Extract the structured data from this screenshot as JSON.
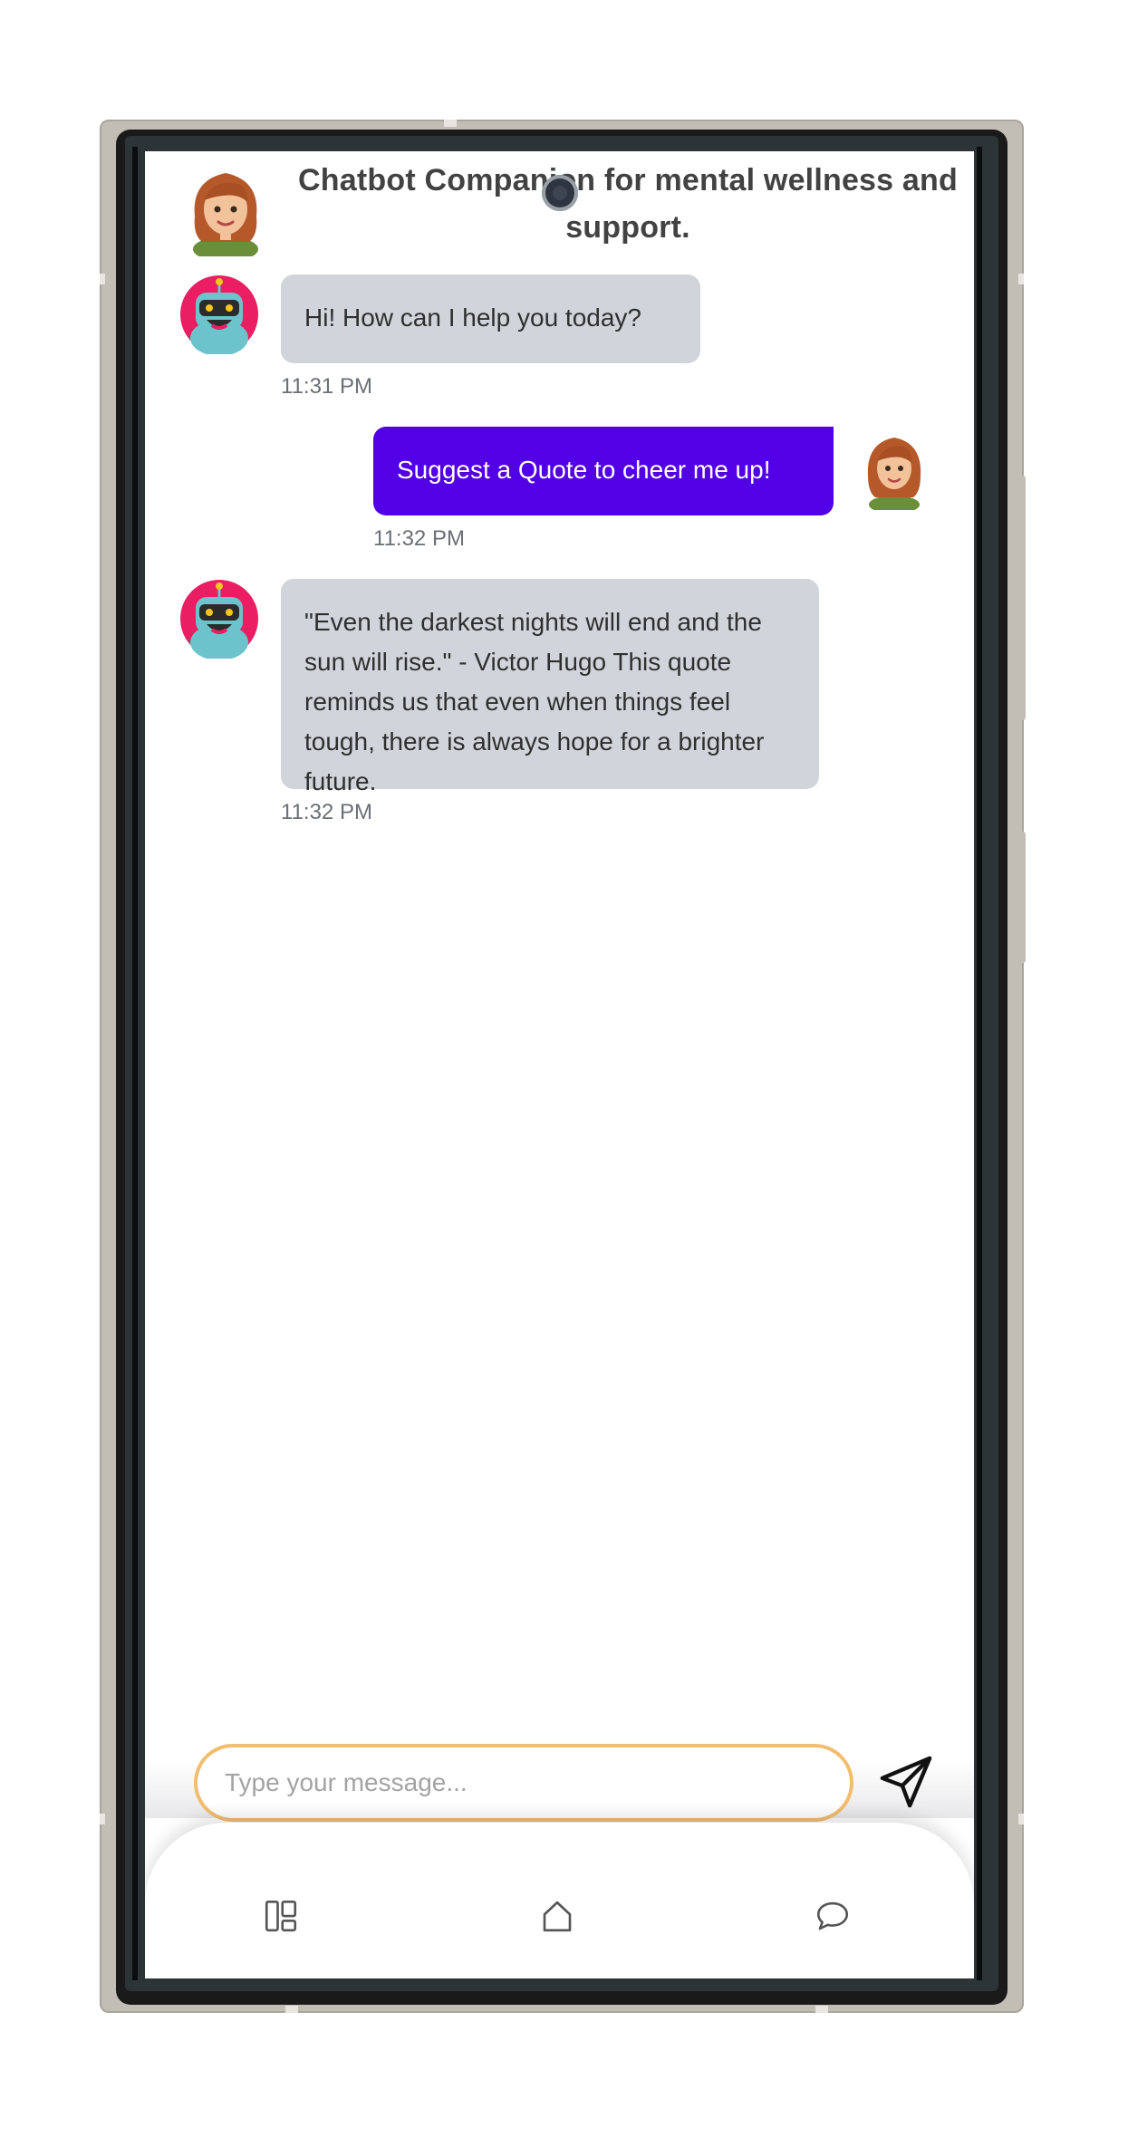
{
  "header": {
    "title": "Chatbot Companion for mental wellness and support."
  },
  "messages": [
    {
      "sender": "bot",
      "text": "Hi! How can I help you today?",
      "time": "11:31 PM"
    },
    {
      "sender": "user",
      "text": "Suggest a Quote to cheer me up!",
      "time": "11:32 PM"
    },
    {
      "sender": "bot",
      "text": "\"Even the darkest nights will end and the sun will rise.\" - Victor Hugo This quote reminds us that even when things feel tough, there is always hope for a brighter future.",
      "time": "11:32 PM"
    }
  ],
  "composer": {
    "placeholder": "Type your message...",
    "send_icon": "send-icon"
  },
  "nav": {
    "items": [
      {
        "icon": "dashboard-icon"
      },
      {
        "icon": "home-icon"
      },
      {
        "icon": "chat-icon"
      }
    ]
  },
  "colors": {
    "user_bubble": "#5200e6",
    "bot_bubble": "#d1d5db",
    "input_border": "#f3bd6f",
    "frame": "#c2bdb5"
  }
}
